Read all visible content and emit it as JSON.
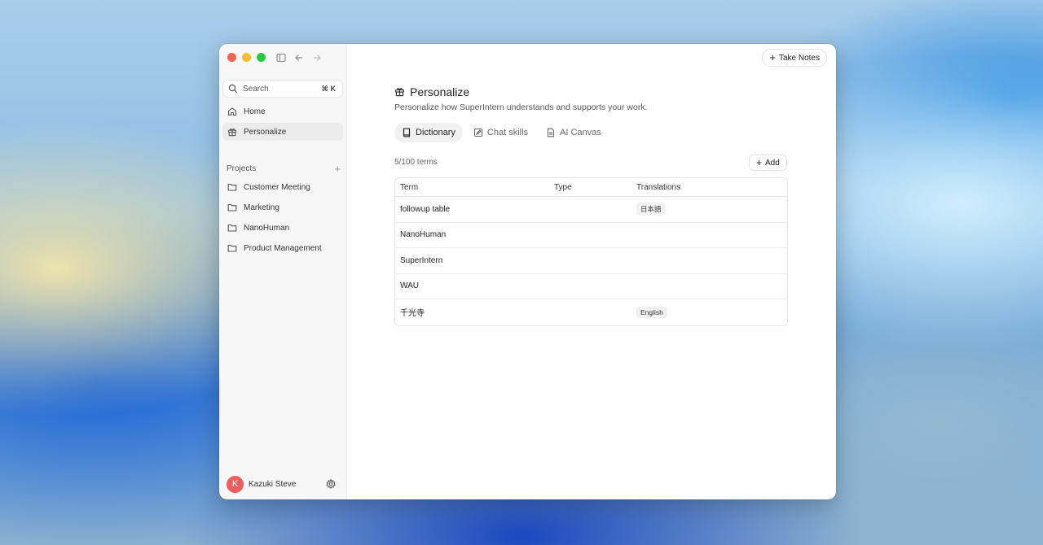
{
  "sidebar": {
    "search": {
      "label": "Search",
      "shortcut": "⌘ K"
    },
    "nav": [
      {
        "label": "Home",
        "icon": "home-icon"
      },
      {
        "label": "Personalize",
        "icon": "gift-icon",
        "active": true
      }
    ],
    "projects_label": "Projects",
    "projects": [
      "Customer Meeting",
      "Marketing",
      "NanoHuman",
      "Product Management"
    ],
    "user": {
      "initial": "K",
      "name": "Kazuki Steve"
    }
  },
  "header": {
    "take_notes_label": "Take Notes"
  },
  "page": {
    "title": "Personalize",
    "subtitle": "Personalize how SuperIntern understands and supports your work."
  },
  "tabs": [
    {
      "label": "Dictionary",
      "icon": "book-icon",
      "active": true
    },
    {
      "label": "Chat skills",
      "icon": "edit-square-icon"
    },
    {
      "label": "AI Canvas",
      "icon": "document-icon"
    }
  ],
  "dictionary": {
    "count_label": "5/100 terms",
    "add_label": "Add",
    "columns": [
      "Term",
      "Type",
      "Translations"
    ],
    "rows": [
      {
        "term": "followup table",
        "type": "",
        "translation": "日本語"
      },
      {
        "term": "NanoHuman",
        "type": "",
        "translation": ""
      },
      {
        "term": "SuperIntern",
        "type": "",
        "translation": ""
      },
      {
        "term": "WAU",
        "type": "",
        "translation": ""
      },
      {
        "term": "千光寺",
        "type": "",
        "translation": "English"
      }
    ]
  },
  "colors": {
    "avatar": "#ee5e5e",
    "close": "#ff5f57",
    "minimize": "#febc2e",
    "zoom": "#28c840"
  }
}
